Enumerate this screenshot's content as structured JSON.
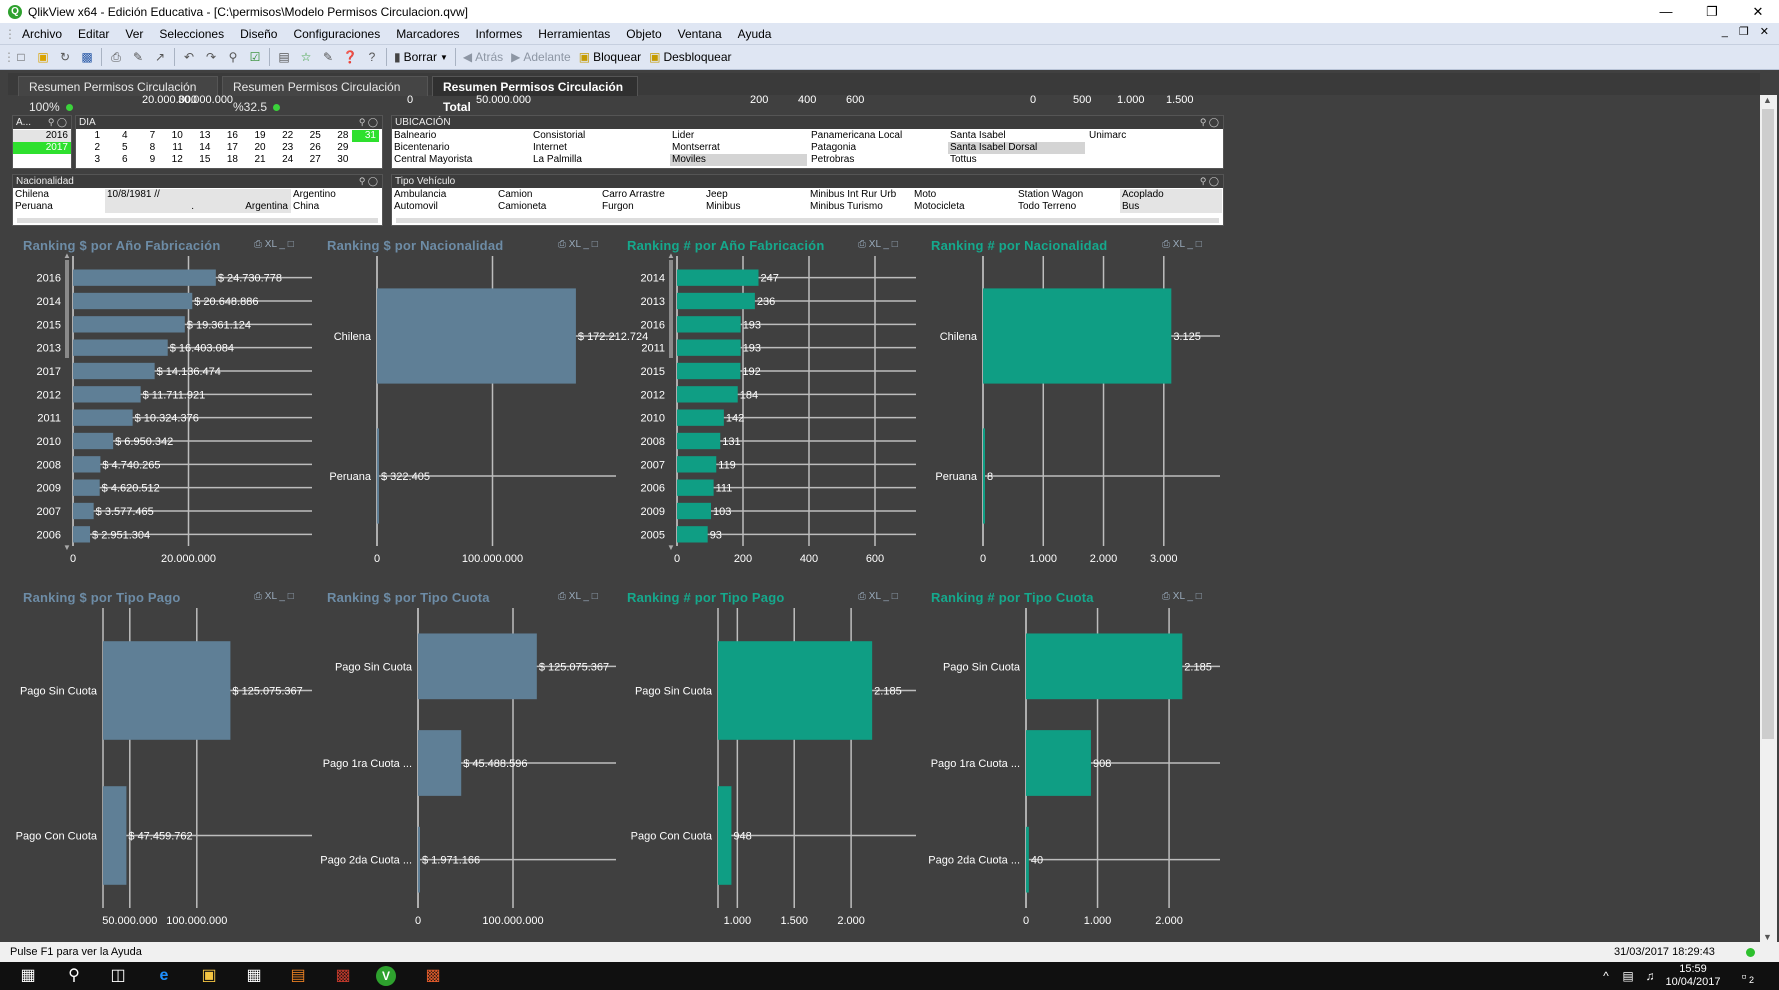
{
  "window": {
    "title": "QlikView x64 - Edición Educativa - [C:\\permisos\\Modelo Permisos Circulacion.qvw]"
  },
  "menu": [
    "Archivo",
    "Editar",
    "Ver",
    "Selecciones",
    "Diseño",
    "Configuraciones",
    "Marcadores",
    "Informes",
    "Herramientas",
    "Objeto",
    "Ventana",
    "Ayuda"
  ],
  "toolbar": {
    "borrar": "Borrar",
    "atras": "Atrás",
    "adelante": "Adelante",
    "bloquear": "Bloquear",
    "desbloquear": "Desbloquear"
  },
  "tabs": [
    "Resumen Permisos Circulación 100%",
    "Resumen Permisos Circulación %32.5",
    "Resumen Permisos Circulación Total"
  ],
  "top_axis_labels": [
    "20.000.000",
    "30.000.000",
    "0",
    "50.000.000",
    "200",
    "400",
    "600",
    "0",
    "500",
    "1.000",
    "1.500"
  ],
  "listboxes": {
    "anio": {
      "title": "A...",
      "values": [
        "2016",
        "2017"
      ]
    },
    "dia": {
      "title": "DIA",
      "rows": [
        [
          "1",
          "4",
          "7",
          "10",
          "13",
          "16",
          "19",
          "22",
          "25",
          "28",
          "31"
        ],
        [
          "2",
          "5",
          "8",
          "11",
          "14",
          "17",
          "20",
          "23",
          "26",
          "29",
          ""
        ],
        [
          "3",
          "6",
          "9",
          "12",
          "15",
          "18",
          "21",
          "24",
          "27",
          "30",
          ""
        ]
      ]
    },
    "ubicacion": {
      "title": "UBICACIÓN",
      "cols": [
        [
          "Balneario",
          "Bicentenario",
          "Central Mayorista"
        ],
        [
          "Consistorial",
          "Internet",
          "La Palmilla"
        ],
        [
          "Lider",
          "Montserrat",
          "Moviles"
        ],
        [
          "Panamericana Local",
          "Patagonia",
          "Petrobras"
        ],
        [
          "Santa Isabel",
          "Santa Isabel Dorsal",
          "Tottus"
        ],
        [
          "Unimarc",
          "",
          ""
        ]
      ]
    },
    "nacionalidad": {
      "title": "Nacionalidad",
      "rows": [
        [
          "Chilena",
          "10/8/1981 //",
          "",
          "Argentino"
        ],
        [
          "Peruana",
          ".",
          "Argentina",
          "China"
        ]
      ]
    },
    "tipo_vehiculo": {
      "title": "Tipo Vehículo",
      "cols": [
        [
          "Ambulancia",
          "Automovil"
        ],
        [
          "Camion",
          "Camioneta"
        ],
        [
          "Carro Arrastre",
          "Furgon"
        ],
        [
          "Jeep",
          "Minibus"
        ],
        [
          "Minibus Int Rur  Urb",
          "Minibus Turismo"
        ],
        [
          "Moto",
          "Motocicleta"
        ],
        [
          "Station Wagon",
          "Todo Terreno"
        ],
        [
          "Acoplado",
          "Bus"
        ]
      ]
    }
  },
  "colors": {
    "blue_bar": "#5f7f96",
    "green_bar": "#0f9e84",
    "bg": "#404040",
    "grid": "#bdbdbd",
    "selected": "#2ee02e"
  },
  "chart_data": [
    {
      "type": "bar",
      "title": "Ranking $ por Año Fabricación",
      "categories": [
        "2016",
        "2014",
        "2015",
        "2013",
        "2017",
        "2012",
        "2011",
        "2010",
        "2008",
        "2009",
        "2007",
        "2006"
      ],
      "values": [
        24730778,
        20648886,
        19361124,
        16403084,
        14136474,
        11711921,
        10324376,
        6950342,
        4740265,
        4620512,
        3577465,
        2951304
      ],
      "labels": [
        "$ 24.730.778",
        "$ 20.648.886",
        "$ 19.361.124",
        "$ 16.403.084",
        "$ 14.136.474",
        "$ 11.711.921",
        "$ 10.324.376",
        "$ 6.950.342",
        "$ 4.740.265",
        "$ 4.620.512",
        "$ 3.577.465",
        "$ 2.951.304"
      ],
      "xticks": [
        "0",
        "20.000.000"
      ],
      "xlim": [
        0,
        40000000
      ]
    },
    {
      "type": "bar",
      "title": "Ranking $ por Nacionalidad",
      "categories": [
        "Chilena",
        "Peruana"
      ],
      "values": [
        172212724,
        322405
      ],
      "labels": [
        "$ 172.212.724",
        "$ 322.405"
      ],
      "xticks": [
        "0",
        "100.000.000"
      ],
      "xlim": [
        0,
        200000000
      ]
    },
    {
      "type": "bar",
      "title": "Ranking # por Año Fabricación",
      "categories": [
        "2014",
        "2013",
        "2016",
        "2011",
        "2015",
        "2012",
        "2010",
        "2008",
        "2007",
        "2006",
        "2009",
        "2005"
      ],
      "values": [
        247,
        236,
        193,
        193,
        192,
        184,
        142,
        131,
        119,
        111,
        103,
        93
      ],
      "labels": [
        "247",
        "236",
        "193",
        "193",
        "192",
        "184",
        "142",
        "131",
        "119",
        "111",
        "103",
        "93"
      ],
      "xticks": [
        "0",
        "200",
        "400",
        "600"
      ],
      "xlim": [
        0,
        700
      ]
    },
    {
      "type": "bar",
      "title": "Ranking # por Nacionalidad",
      "categories": [
        "Chilena",
        "Peruana"
      ],
      "values": [
        3125,
        8
      ],
      "labels": [
        "3.125",
        "8"
      ],
      "xticks": [
        "0",
        "1.000",
        "2.000",
        "3.000"
      ],
      "xlim": [
        0,
        3800
      ]
    },
    {
      "type": "bar",
      "title": "Ranking $ por Tipo Pago",
      "categories": [
        "Pago Sin Cuota",
        "Pago Con Cuota"
      ],
      "values": [
        125075367,
        47459762
      ],
      "labels": [
        "$ 125.075.367",
        "$ 47.459.762"
      ],
      "xticks": [
        "50.000.000",
        "100.000.000"
      ],
      "xlim": [
        30000000,
        180000000
      ]
    },
    {
      "type": "bar",
      "title": "Ranking $ por Tipo Cuota",
      "categories": [
        "Pago Sin Cuota",
        "Pago 1ra Cuota ...",
        "Pago 2da Cuota ..."
      ],
      "values": [
        125075367,
        45488596,
        1971166
      ],
      "labels": [
        "$ 125.075.367",
        "$ 45.488.596",
        "$ 1.971.166"
      ],
      "xticks": [
        "0",
        "100.000.000"
      ],
      "xlim": [
        0,
        200000000
      ]
    },
    {
      "type": "bar",
      "title": "Ranking # por Tipo Pago",
      "categories": [
        "Pago Sin Cuota",
        "Pago Con Cuota"
      ],
      "values": [
        2185,
        948
      ],
      "labels": [
        "2.185",
        "948"
      ],
      "xticks": [
        "1.000",
        "1.500",
        "2.000"
      ],
      "xlim": [
        830,
        2500
      ]
    },
    {
      "type": "bar",
      "title": "Ranking # por Tipo Cuota",
      "categories": [
        "Pago Sin Cuota",
        "Pago 1ra Cuota ...",
        "Pago 2da Cuota ..."
      ],
      "values": [
        2185,
        908,
        40
      ],
      "labels": [
        "2.185",
        "908",
        "40"
      ],
      "xticks": [
        "0",
        "1.000",
        "2.000"
      ],
      "xlim": [
        0,
        2600
      ]
    }
  ],
  "status": {
    "help": "Pulse F1 para ver la Ayuda",
    "timestamp": "31/03/2017 18:29:43"
  },
  "taskbar": {
    "time": "15:59",
    "date": "10/04/2017",
    "notif": "2"
  }
}
